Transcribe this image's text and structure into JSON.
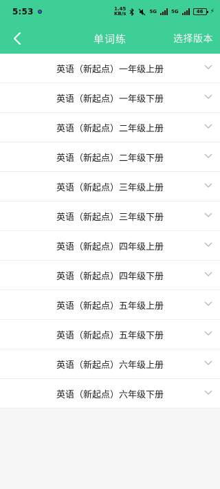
{
  "status_bar": {
    "time": "5:53",
    "net_speed_value": "1.45",
    "net_speed_unit": "KB/s",
    "net_type_1": "5G",
    "net_type_2": "5G",
    "battery": "46",
    "icons": [
      "bluetooth-icon",
      "mute-icon",
      "signal-icon",
      "signal-icon",
      "battery-icon",
      "charging-icon"
    ]
  },
  "nav": {
    "title": "单词练",
    "action_label": "选择版本",
    "back_icon": "chevron-left-icon"
  },
  "items": [
    {
      "label": "英语（新起点）一年级上册"
    },
    {
      "label": "英语（新起点）一年级下册"
    },
    {
      "label": "英语（新起点）二年级上册"
    },
    {
      "label": "英语（新起点）二年级下册"
    },
    {
      "label": "英语（新起点）三年级上册"
    },
    {
      "label": "英语（新起点）三年级下册"
    },
    {
      "label": "英语（新起点）四年级上册"
    },
    {
      "label": "英语（新起点）四年级下册"
    },
    {
      "label": "英语（新起点）五年级上册"
    },
    {
      "label": "英语（新起点）五年级下册"
    },
    {
      "label": "英语（新起点）六年级上册"
    },
    {
      "label": "英语（新起点）六年级下册"
    }
  ],
  "colors": {
    "accent": "#3ecf96",
    "text": "#222222",
    "chevron": "#b5b5b5",
    "background": "#f7f7f7"
  }
}
